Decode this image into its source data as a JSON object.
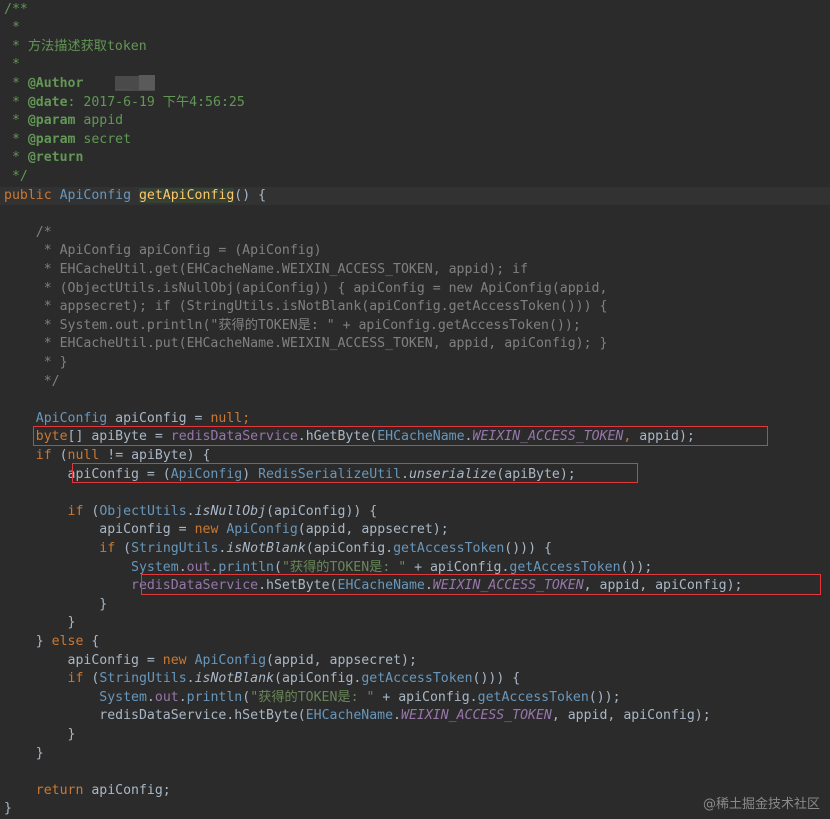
{
  "colors": {
    "background": "#2b2b2b",
    "default": "#a9b7c6",
    "keyword": "#cc7832",
    "type": "#6897bb",
    "doc_comment": "#629755",
    "comment": "#808080",
    "field": "#9876aa",
    "method_declaration": "#ffc66d",
    "string": "#6a8759",
    "highlight_box": "#e0383b"
  },
  "editor": {
    "lines": [
      [
        {
          "t": "/**",
          "c": "doc"
        }
      ],
      [
        {
          "t": " *",
          "c": "doc"
        }
      ],
      [
        {
          "t": " * 方法描述获取token",
          "c": "doc"
        }
      ],
      [
        {
          "t": " *",
          "c": "doc"
        }
      ],
      [
        {
          "t": " * ",
          "c": "doc"
        },
        {
          "t": "@Author",
          "c": "doc-tag"
        },
        {
          "t": "    ",
          "c": "doc"
        },
        {
          "t": "__ ██",
          "c": "redact"
        }
      ],
      [
        {
          "t": " * ",
          "c": "doc"
        },
        {
          "t": "@date",
          "c": "doc-tag"
        },
        {
          "t": ": 2017-6-19 下午4:56:25",
          "c": "doc"
        }
      ],
      [
        {
          "t": " * ",
          "c": "doc"
        },
        {
          "t": "@param",
          "c": "doc-tag"
        },
        {
          "t": " appid",
          "c": "doc"
        }
      ],
      [
        {
          "t": " * ",
          "c": "doc"
        },
        {
          "t": "@param",
          "c": "doc-tag"
        },
        {
          "t": " secret",
          "c": "doc"
        }
      ],
      [
        {
          "t": " * ",
          "c": "doc"
        },
        {
          "t": "@return",
          "c": "doc-tag"
        }
      ],
      [
        {
          "t": " */",
          "c": "doc"
        }
      ],
      [
        {
          "t": "public ",
          "c": "kw"
        },
        {
          "t": "ApiConfig ",
          "c": "type"
        },
        {
          "t": "getApiConfig",
          "c": "hl"
        },
        {
          "t": "() {",
          "c": "def"
        }
      ],
      [
        {
          "t": "",
          "c": "def"
        }
      ],
      [
        {
          "t": "    /*",
          "c": "comment"
        }
      ],
      [
        {
          "t": "     * ApiConfig apiConfig = (ApiConfig)",
          "c": "comment"
        }
      ],
      [
        {
          "t": "     * EHCacheUtil.get(EHCacheName.WEIXIN_ACCESS_TOKEN, appid); if",
          "c": "comment"
        }
      ],
      [
        {
          "t": "     * (ObjectUtils.isNullObj(apiConfig)) { apiConfig = new ApiConfig(appid,",
          "c": "comment"
        }
      ],
      [
        {
          "t": "     * appsecret); if (StringUtils.isNotBlank(apiConfig.getAccessToken())) {",
          "c": "comment"
        }
      ],
      [
        {
          "t": "     * System.out.println(\"获得的TOKEN是: \" + apiConfig.getAccessToken());",
          "c": "comment"
        }
      ],
      [
        {
          "t": "     * EHCacheUtil.put(EHCacheName.WEIXIN_ACCESS_TOKEN, appid, apiConfig); }",
          "c": "comment"
        }
      ],
      [
        {
          "t": "     * }",
          "c": "comment"
        }
      ],
      [
        {
          "t": "     */",
          "c": "comment"
        }
      ],
      [
        {
          "t": "",
          "c": "def"
        }
      ],
      [
        {
          "t": "    ApiConfig ",
          "c": "type"
        },
        {
          "t": "apiConfig = ",
          "c": "def"
        },
        {
          "t": "null",
          "c": "kw"
        },
        {
          "t": ";",
          "c": "kw"
        }
      ],
      [
        {
          "t": "    ",
          "c": "def"
        },
        {
          "t": "byte",
          "c": "kw"
        },
        {
          "t": "[] apiByte = ",
          "c": "def"
        },
        {
          "t": "redisDataService",
          "c": "field"
        },
        {
          "t": ".hGetByte(",
          "c": "def"
        },
        {
          "t": "EHCacheName",
          "c": "type"
        },
        {
          "t": ".",
          "c": "def"
        },
        {
          "t": "WEIXIN_ACCESS_TOKEN",
          "c": "static"
        },
        {
          "t": ", ",
          "c": "kw"
        },
        {
          "t": "appid);",
          "c": "def"
        }
      ],
      [
        {
          "t": "    ",
          "c": "def"
        },
        {
          "t": "if ",
          "c": "kw"
        },
        {
          "t": "(",
          "c": "def"
        },
        {
          "t": "null ",
          "c": "kw"
        },
        {
          "t": "!= apiByte) {",
          "c": "def"
        }
      ],
      [
        {
          "t": "        apiConfig = (",
          "c": "def"
        },
        {
          "t": "ApiConfig",
          "c": "type"
        },
        {
          "t": ") ",
          "c": "def"
        },
        {
          "t": "RedisSerializeUtil",
          "c": "type"
        },
        {
          "t": ".",
          "c": "def"
        },
        {
          "t": "unserialize",
          "c": "smethod"
        },
        {
          "t": "(apiByte);",
          "c": "def"
        }
      ],
      [
        {
          "t": "",
          "c": "def"
        }
      ],
      [
        {
          "t": "        ",
          "c": "def"
        },
        {
          "t": "if ",
          "c": "kw"
        },
        {
          "t": "(",
          "c": "def"
        },
        {
          "t": "ObjectUtils",
          "c": "type"
        },
        {
          "t": ".",
          "c": "def"
        },
        {
          "t": "isNullObj",
          "c": "smethod"
        },
        {
          "t": "(apiConfig)) {",
          "c": "def"
        }
      ],
      [
        {
          "t": "            apiConfig = ",
          "c": "def"
        },
        {
          "t": "new ",
          "c": "kw"
        },
        {
          "t": "ApiConfig",
          "c": "type"
        },
        {
          "t": "(appid, appsecret);",
          "c": "def"
        }
      ],
      [
        {
          "t": "            ",
          "c": "def"
        },
        {
          "t": "if ",
          "c": "kw"
        },
        {
          "t": "(",
          "c": "def"
        },
        {
          "t": "StringUtils",
          "c": "type"
        },
        {
          "t": ".",
          "c": "def"
        },
        {
          "t": "isNotBlank",
          "c": "smethod"
        },
        {
          "t": "(apiConfig.",
          "c": "def"
        },
        {
          "t": "getAccessToken",
          "c": "type"
        },
        {
          "t": "())) {",
          "c": "def"
        }
      ],
      [
        {
          "t": "                ",
          "c": "def"
        },
        {
          "t": "System",
          "c": "type"
        },
        {
          "t": ".",
          "c": "def"
        },
        {
          "t": "out",
          "c": "field"
        },
        {
          "t": ".",
          "c": "def"
        },
        {
          "t": "println",
          "c": "type"
        },
        {
          "t": "(",
          "c": "def"
        },
        {
          "t": "\"获得的TOKEN是: \"",
          "c": "string"
        },
        {
          "t": " + apiConfig.",
          "c": "def"
        },
        {
          "t": "getAccessToken",
          "c": "type"
        },
        {
          "t": "());",
          "c": "def"
        }
      ],
      [
        {
          "t": "                ",
          "c": "def"
        },
        {
          "t": "redisDataService",
          "c": "field"
        },
        {
          "t": ".hSetByte(",
          "c": "def"
        },
        {
          "t": "EHCacheName",
          "c": "type"
        },
        {
          "t": ".",
          "c": "def"
        },
        {
          "t": "WEIXIN_ACCESS_TOKEN",
          "c": "static"
        },
        {
          "t": ", appid, apiConfig);",
          "c": "def"
        }
      ],
      [
        {
          "t": "            }",
          "c": "def"
        }
      ],
      [
        {
          "t": "        }",
          "c": "def"
        }
      ],
      [
        {
          "t": "    } ",
          "c": "def"
        },
        {
          "t": "else ",
          "c": "kw"
        },
        {
          "t": "{",
          "c": "def"
        }
      ],
      [
        {
          "t": "        apiConfig = ",
          "c": "def"
        },
        {
          "t": "new ",
          "c": "kw"
        },
        {
          "t": "ApiConfig",
          "c": "type"
        },
        {
          "t": "(appid, appsecret);",
          "c": "def"
        }
      ],
      [
        {
          "t": "        ",
          "c": "def"
        },
        {
          "t": "if ",
          "c": "kw"
        },
        {
          "t": "(",
          "c": "def"
        },
        {
          "t": "StringUtils",
          "c": "type"
        },
        {
          "t": ".",
          "c": "def"
        },
        {
          "t": "isNotBlank",
          "c": "smethod"
        },
        {
          "t": "(apiConfig.",
          "c": "def"
        },
        {
          "t": "getAccessToken",
          "c": "type"
        },
        {
          "t": "())) {",
          "c": "def"
        }
      ],
      [
        {
          "t": "            ",
          "c": "def"
        },
        {
          "t": "System",
          "c": "type"
        },
        {
          "t": ".",
          "c": "def"
        },
        {
          "t": "out",
          "c": "field"
        },
        {
          "t": ".",
          "c": "def"
        },
        {
          "t": "println",
          "c": "type"
        },
        {
          "t": "(",
          "c": "def"
        },
        {
          "t": "\"获得的TOKEN是: \"",
          "c": "string"
        },
        {
          "t": " + apiConfig.",
          "c": "def"
        },
        {
          "t": "getAccessToken",
          "c": "type"
        },
        {
          "t": "());",
          "c": "def"
        }
      ],
      [
        {
          "t": "            redisDataService.hSetByte(",
          "c": "def"
        },
        {
          "t": "EHCacheName",
          "c": "type"
        },
        {
          "t": ".",
          "c": "def"
        },
        {
          "t": "WEIXIN_ACCESS_TOKEN",
          "c": "static"
        },
        {
          "t": ", appid, apiConfig);",
          "c": "def"
        }
      ],
      [
        {
          "t": "        }",
          "c": "def"
        }
      ],
      [
        {
          "t": "    }",
          "c": "def"
        }
      ],
      [
        {
          "t": "",
          "c": "def"
        }
      ],
      [
        {
          "t": "    ",
          "c": "def"
        },
        {
          "t": "return ",
          "c": "kw"
        },
        {
          "t": "apiConfig;",
          "c": "def"
        }
      ],
      [
        {
          "t": "}",
          "c": "def"
        }
      ]
    ]
  },
  "watermark": "@稀土掘金技术社区"
}
